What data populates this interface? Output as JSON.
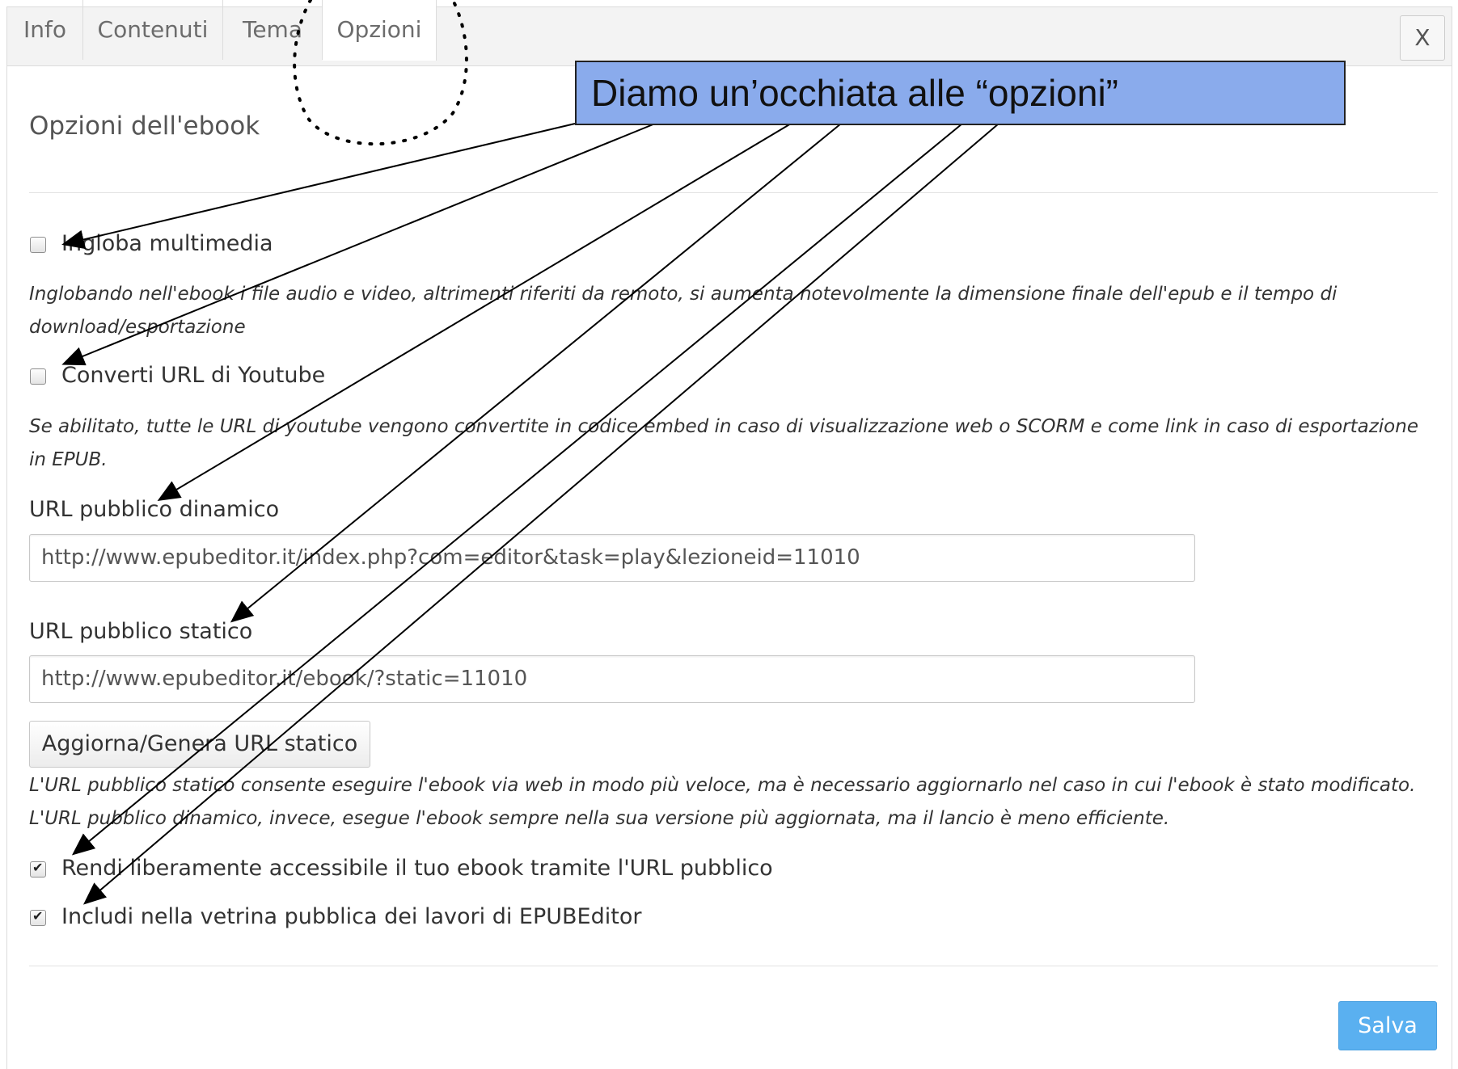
{
  "tabs": [
    {
      "label": "Info",
      "active": false
    },
    {
      "label": "Contenuti",
      "active": false
    },
    {
      "label": "Tema",
      "active": false
    },
    {
      "label": "Opzioni",
      "active": true
    }
  ],
  "close_label": "X",
  "title": "Opzioni dell'ebook",
  "options": {
    "ingloba": {
      "label": "Ingloba multimedia",
      "checked": false,
      "help": "Inglobando nell'ebook i file audio e video, altrimenti riferiti da remoto, si aumenta notevolmente la dimensione finale dell'epub e il tempo di download/esportazione"
    },
    "youtube": {
      "label": "Converti URL di Youtube",
      "checked": false,
      "help": "Se abilitato, tutte le URL di youtube vengono convertite in codice embed in caso di visualizzazione web o SCORM e come link in caso di esportazione in EPUB."
    },
    "accessibile": {
      "label": "Rendi liberamente accessibile il tuo ebook tramite l'URL pubblico",
      "checked": true
    },
    "vetrina": {
      "label": "Includi nella vetrina pubblica dei lavori di EPUBEditor",
      "checked": true
    }
  },
  "url_dinamico": {
    "label": "URL pubblico dinamico",
    "value": "http://www.epubeditor.it/index.php?com=editor&task=play&lezioneid=11010"
  },
  "url_statico": {
    "label": "URL pubblico statico",
    "value": "http://www.epubeditor.it/ebook/?static=11010",
    "button": "Aggiorna/Genera URL statico",
    "help": "L'URL pubblico statico consente eseguire l'ebook via web in modo più veloce, ma è necessario aggiornarlo nel caso in cui l'ebook è stato modificato. L'URL pubblico dinamico, invece, esegue l'ebook sempre nella sua versione più aggiornata, ma il lancio è meno efficiente."
  },
  "save_label": "Salva",
  "callout": "Diamo un’occhiata alle “opzioni”",
  "colors": {
    "callout_bg": "#8aabec",
    "save_bg": "#5ab0f0"
  }
}
